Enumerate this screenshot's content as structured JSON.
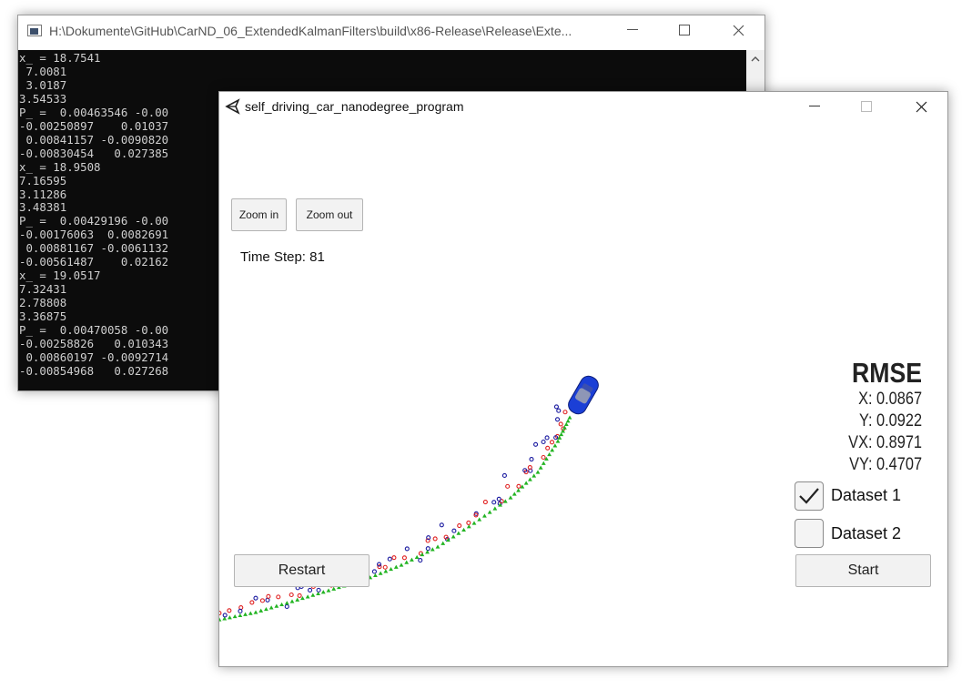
{
  "console_window": {
    "title": "H:\\Dokumente\\GitHub\\CarND_06_ExtendedKalmanFilters\\build\\x86-Release\\Release\\Exte...",
    "lines": [
      "x_ = 18.7541",
      " 7.0081",
      " 3.0187",
      "3.54533",
      "P_ =  0.00463546 -0.00",
      "-0.00250897    0.01037",
      " 0.00841157 -0.0090820",
      "-0.00830454   0.027385",
      "x_ = 18.9508",
      "7.16595",
      "3.11286",
      "3.48381",
      "P_ =  0.00429196 -0.00",
      "-0.00176063  0.0082691",
      " 0.00881167 -0.0061132",
      "-0.00561487    0.02162",
      "x_ = 19.0517",
      "7.32431",
      "2.78808",
      "3.36875",
      "P_ =  0.00470058 -0.00",
      "-0.00258826   0.010343",
      " 0.00860197 -0.0092714",
      "-0.00854968   0.027268"
    ]
  },
  "sim_window": {
    "title": "self_driving_car_nanodegree_program",
    "zoom_in_label": "Zoom in",
    "zoom_out_label": "Zoom out",
    "time_step_text": "Time Step: 81",
    "rmse": {
      "title": "RMSE",
      "x": "X: 0.0867",
      "y": "Y: 0.0922",
      "vx": "VX: 0.8971",
      "vy": "VY: 0.4707"
    },
    "dataset1_label": "Dataset 1",
    "dataset1_checked": true,
    "dataset2_label": "Dataset 2",
    "dataset2_checked": false,
    "restart_label": "Restart",
    "start_label": "Start"
  },
  "colors": {
    "estimate_marker": "#22b422",
    "lidar_marker": "#e02020",
    "radar_marker": "#1a1aa0",
    "car": "#1b3fd6",
    "console_bg": "#0c0c0c",
    "console_text": "#cfcfcf"
  },
  "icons": {
    "console": "cmd-window-icon",
    "sim": "unity-logo-icon",
    "minimize": "minimize-icon",
    "maximize": "maximize-icon",
    "close": "close-icon",
    "check": "checkmark-icon",
    "scroll_up": "chevron-up-icon"
  }
}
